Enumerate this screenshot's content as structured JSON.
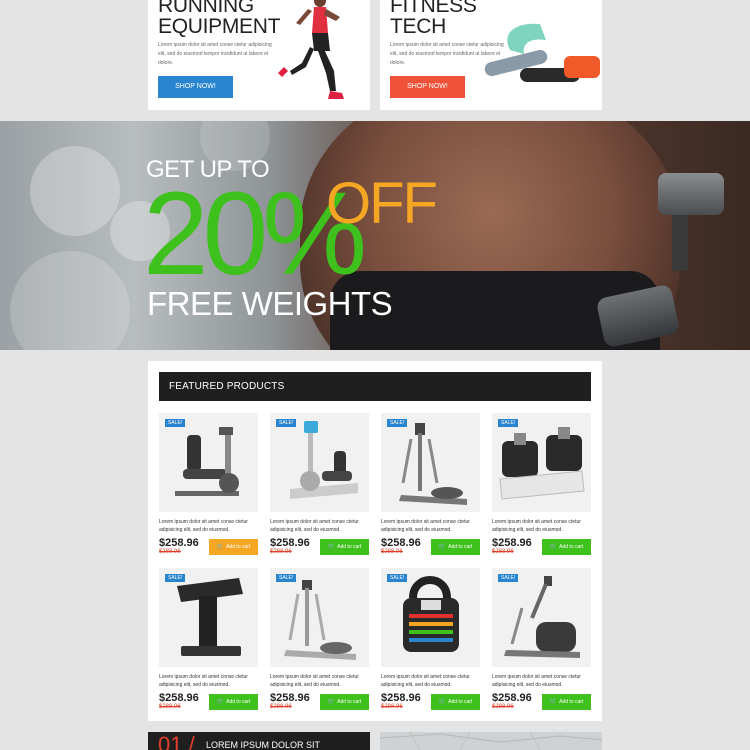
{
  "promos": [
    {
      "title_line1": "RUNNING",
      "title_line2": "EQUIPMENT",
      "text": "Lorem ipsum dolor sit amet conse ctetur adipisicing elit, sed do eiusmod tempor incididunt ut labore et dolore.",
      "button": "SHOP NOW!",
      "button_color": "#2a85d0"
    },
    {
      "title_line1": "FITNESS",
      "title_line2": "TECH",
      "text": "Lorem ipsum dolor sit amet conse ctetur adipisicing elit, sed do eiusmod tempor incididunt ut labore et dolore.",
      "button": "SHOP NOW!",
      "button_color": "#f05238"
    }
  ],
  "hero": {
    "line1": "GET UP TO",
    "percent": "20%",
    "off": "OFF",
    "line3": "FREE WEIGHTS",
    "percent_color": "#3ec11d",
    "off_color": "#f5a623"
  },
  "featured": {
    "heading": "FEATURED PRODUCTS",
    "products": [
      {
        "badge": "SALE!",
        "icon": "recumbent-bike-icon",
        "desc": "Lorem ipsum dolor sit amet conse ctetur adipisicing elit, sed do eiusmod.",
        "price": "$258.96",
        "old_price": "$288.96",
        "cart": "Add to cart",
        "cart_color": "#f5a623"
      },
      {
        "badge": "SALE!",
        "icon": "recumbent-bike-icon",
        "desc": "Lorem ipsum dolor sit amet conse ctetur adipisicing elit, sed do eiusmod.",
        "price": "$258.96",
        "old_price": "$288.96",
        "cart": "Add to cart",
        "cart_color": "#3ec11d"
      },
      {
        "badge": "SALE!",
        "icon": "elliptical-icon",
        "desc": "Lorem ipsum dolor sit amet conse ctetur adipisicing elit, sed do eiusmod.",
        "price": "$258.96",
        "old_price": "$288.96",
        "cart": "Add to cart",
        "cart_color": "#3ec11d"
      },
      {
        "badge": "SALE!",
        "icon": "dumbbells-icon",
        "desc": "Lorem ipsum dolor sit amet conse ctetur adipisicing elit, sed do eiusmod.",
        "price": "$258.96",
        "old_price": "$288.96",
        "cart": "Add to cart",
        "cart_color": "#3ec11d"
      },
      {
        "badge": "SALE!",
        "icon": "weight-stand-icon",
        "desc": "Lorem ipsum dolor sit amet conse ctetur adipisicing elit, sed do eiusmod.",
        "price": "$258.96",
        "old_price": "$288.96",
        "cart": "Add to cart",
        "cart_color": "#3ec11d"
      },
      {
        "badge": "SALE!",
        "icon": "elliptical-icon",
        "desc": "Lorem ipsum dolor sit amet conse ctetur adipisicing elit, sed do eiusmod.",
        "price": "$258.96",
        "old_price": "$288.96",
        "cart": "Add to cart",
        "cart_color": "#3ec11d"
      },
      {
        "badge": "SALE!",
        "icon": "kettlebell-icon",
        "desc": "Lorem ipsum dolor sit amet conse ctetur adipisicing elit, sed do eiusmod.",
        "price": "$258.96",
        "old_price": "$288.96",
        "cart": "Add to cart",
        "cart_color": "#3ec11d"
      },
      {
        "badge": "SALE!",
        "icon": "stepper-icon",
        "desc": "Lorem ipsum dolor sit amet conse ctetur adipisicing elit, sed do eiusmod.",
        "price": "$258.96",
        "old_price": "$288.96",
        "cart": "Add to cart",
        "cart_color": "#3ec11d"
      }
    ]
  },
  "bottom": {
    "number": "01 /",
    "title": "LOREM IPSUM DOLOR SIT"
  }
}
